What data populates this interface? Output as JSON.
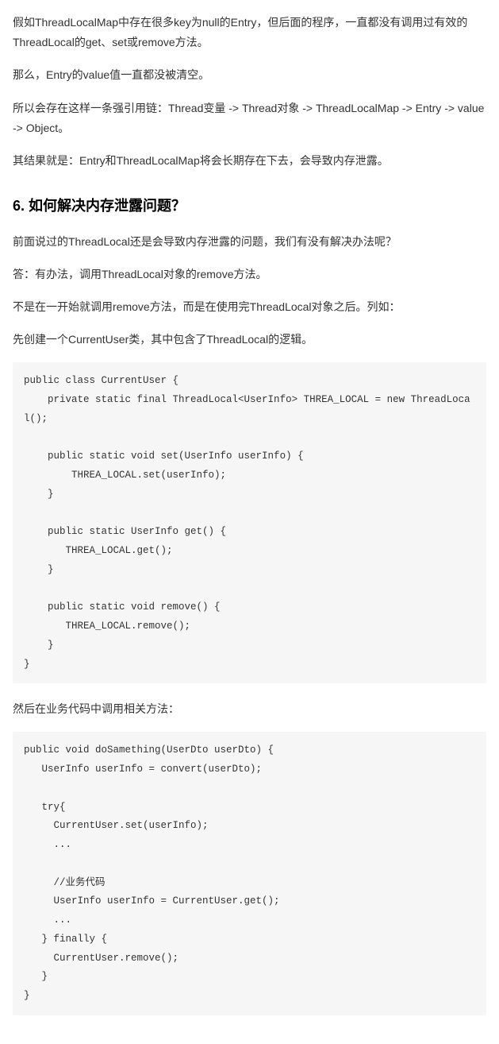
{
  "paragraphs": {
    "p1": "假如ThreadLocalMap中存在很多key为null的Entry，但后面的程序，一直都没有调用过有效的ThreadLocal的get、set或remove方法。",
    "p2": "那么，Entry的value值一直都没被清空。",
    "p3": "所以会存在这样一条强引用链：Thread变量 -> Thread对象 -> ThreadLocalMap -> Entry -> value -> Object。",
    "p4": "其结果就是：Entry和ThreadLocalMap将会长期存在下去，会导致内存泄露。",
    "h2": "6. 如何解决内存泄露问题？",
    "p5": "前面说过的ThreadLocal还是会导致内存泄露的问题，我们有没有解决办法呢？",
    "p6": "答：有办法，调用ThreadLocal对象的remove方法。",
    "p7": "不是在一开始就调用remove方法，而是在使用完ThreadLocal对象之后。列如：",
    "p8": "先创建一个CurrentUser类，其中包含了ThreadLocal的逻辑。",
    "p9": "然后在业务代码中调用相关方法："
  },
  "code1": "public class CurrentUser {\n    private static final ThreadLocal<UserInfo> THREA_LOCAL = new ThreadLocal();\n\n    public static void set(UserInfo userInfo) {\n        THREA_LOCAL.set(userInfo);\n    }\n\n    public static UserInfo get() {\n       THREA_LOCAL.get();\n    }\n\n    public static void remove() {\n       THREA_LOCAL.remove();\n    }\n}",
  "code2": "public void doSamething(UserDto userDto) {\n   UserInfo userInfo = convert(userDto);\n\n   try{\n     CurrentUser.set(userInfo);\n     ...\n\n     //业务代码\n     UserInfo userInfo = CurrentUser.get();\n     ...\n   } finally {\n     CurrentUser.remove();\n   }\n}"
}
